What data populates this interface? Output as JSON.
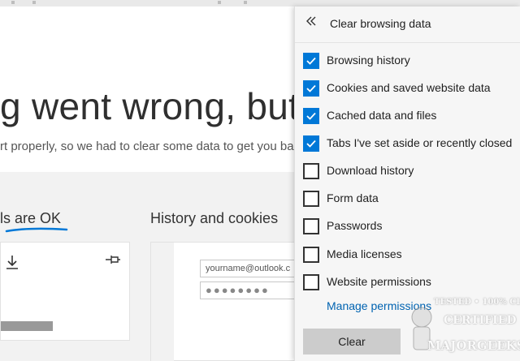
{
  "background_page": {
    "headline": "g went wrong, but w",
    "subline": "rt properly, so we had to clear some data to get you ba",
    "card_1_title": "ls are OK",
    "card_2_title": "History and cookies",
    "email_value": "yourname@outlook.c",
    "password_mask": "●●●●●●●●",
    "accent_color": "#0078d7"
  },
  "panel": {
    "title": "Clear browsing data",
    "back_icon": "double-chevron-left-icon",
    "options": [
      {
        "label": "Browsing history",
        "checked": true
      },
      {
        "label": "Cookies and saved website data",
        "checked": true
      },
      {
        "label": "Cached data and files",
        "checked": true
      },
      {
        "label": "Tabs I've set aside or recently closed",
        "checked": true
      },
      {
        "label": "Download history",
        "checked": false
      },
      {
        "label": "Form data",
        "checked": false
      },
      {
        "label": "Passwords",
        "checked": false
      },
      {
        "label": "Media licenses",
        "checked": false
      },
      {
        "label": "Website permissions",
        "checked": false
      }
    ],
    "manage_link": "Manage permissions",
    "clear_button": "Clear"
  },
  "watermark": {
    "line1": "TESTED • 100% CLEAN",
    "line2": "CERTIFIED",
    "line3": "MAJORGEEKS"
  }
}
